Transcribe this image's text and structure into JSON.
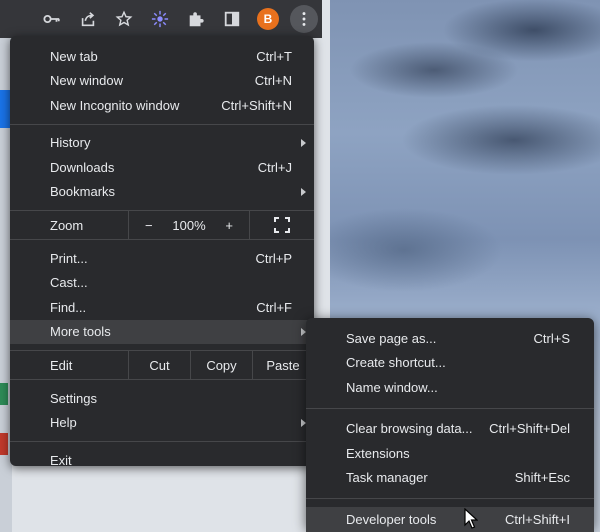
{
  "toolbar": {
    "icons": [
      "key-icon",
      "share-icon",
      "star-icon",
      "extension-burst-icon",
      "puzzle-icon",
      "side-panel-icon"
    ],
    "avatar_letter": "B",
    "avatar_color": "#e8711d"
  },
  "menu": {
    "new_tab": {
      "label": "New tab",
      "shortcut": "Ctrl+T"
    },
    "new_window": {
      "label": "New window",
      "shortcut": "Ctrl+N"
    },
    "new_incognito": {
      "label": "New Incognito window",
      "shortcut": "Ctrl+Shift+N"
    },
    "history": {
      "label": "History"
    },
    "downloads": {
      "label": "Downloads",
      "shortcut": "Ctrl+J"
    },
    "bookmarks": {
      "label": "Bookmarks"
    },
    "zoom": {
      "label": "Zoom",
      "minus": "−",
      "value": "100%",
      "plus": "+"
    },
    "print": {
      "label": "Print...",
      "shortcut": "Ctrl+P"
    },
    "cast": {
      "label": "Cast..."
    },
    "find": {
      "label": "Find...",
      "shortcut": "Ctrl+F"
    },
    "more_tools": {
      "label": "More tools"
    },
    "edit": {
      "label": "Edit",
      "cut": "Cut",
      "copy": "Copy",
      "paste": "Paste"
    },
    "settings": {
      "label": "Settings"
    },
    "help": {
      "label": "Help"
    },
    "exit": {
      "label": "Exit"
    }
  },
  "submenu": {
    "save_page": {
      "label": "Save page as...",
      "shortcut": "Ctrl+S"
    },
    "create_shortcut": {
      "label": "Create shortcut..."
    },
    "name_window": {
      "label": "Name window..."
    },
    "clear_browsing": {
      "label": "Clear browsing data...",
      "shortcut": "Ctrl+Shift+Del"
    },
    "extensions": {
      "label": "Extensions"
    },
    "task_manager": {
      "label": "Task manager",
      "shortcut": "Shift+Esc"
    },
    "developer_tools": {
      "label": "Developer tools",
      "shortcut": "Ctrl+Shift+I"
    }
  },
  "colors": {
    "menu_bg": "#292a2d",
    "highlight": "#3f4043",
    "text": "#e8eaed"
  }
}
